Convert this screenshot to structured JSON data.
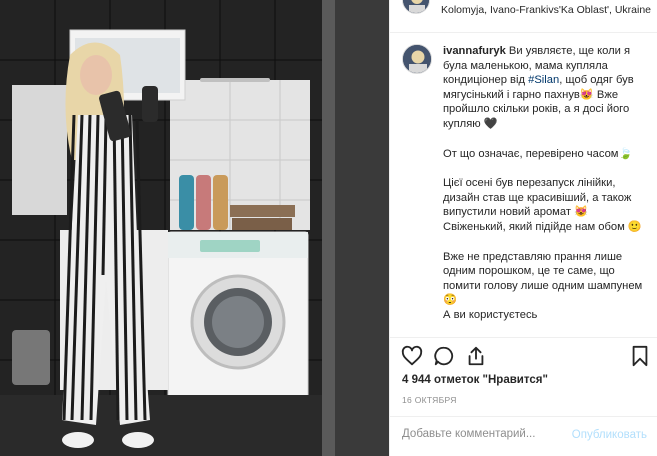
{
  "post": {
    "location": "Kolomyja, Ivano-Frankivs'Ka Oblast', Ukraine",
    "username": "ivannafuryk",
    "caption": {
      "p1_text": "Ви уявляєте, ще коли я була маленькою, мама купляла кондиціонер від ",
      "hashtag": "#Silan",
      "p1_text_after": ", щоб одяг був мягусінький і гарно пахнув😻 Вже пройшло скільки років, а я досі його купляю 🖤",
      "p2": "От що означає, перевірено часом🍃",
      "p3": "Цієї осені був перезапуск лінійки, дизайн став ще красивіший, а також випустили новий аромат 😻 Свіженький, який підійде нам обом 🙂",
      "p4": "Вже не представляю прання лише одним порошком, це те саме, що помити голову лише одним шампунем😳",
      "p5": "А ви користуєтесь"
    },
    "likes_text": "4 944 отметок \"Нравится\"",
    "date": "16 октября",
    "comment_placeholder": "Добавьте комментарий...",
    "publish_label": "Опубликовать"
  },
  "icons": {
    "like": "heart-icon",
    "comment": "comment-bubble-icon",
    "share": "share-icon",
    "save": "bookmark-icon"
  },
  "colors": {
    "link": "#00376b",
    "publish_disabled": "#b2dffc",
    "muted": "#8e8e8e",
    "divider": "#efefef"
  }
}
